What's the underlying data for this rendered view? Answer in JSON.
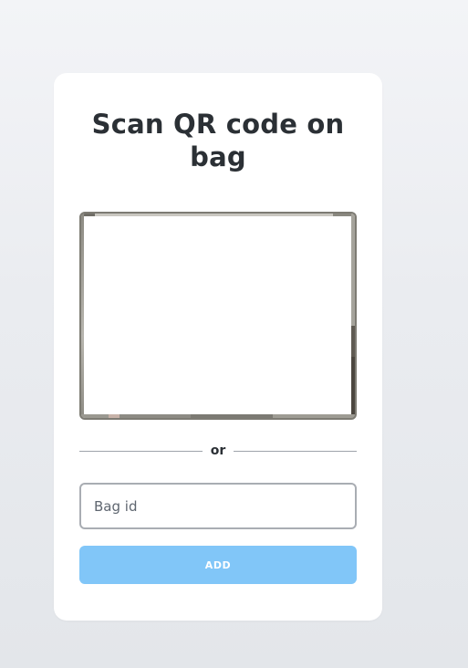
{
  "card": {
    "title": "Scan QR code on bag"
  },
  "divider": {
    "label": "or"
  },
  "bag_input": {
    "value": "",
    "placeholder": "Bag id"
  },
  "add_button": {
    "label": "ADD",
    "state": "disabled"
  },
  "colors": {
    "background": "#e9ebef",
    "card": "#ffffff",
    "title_text": "#2b3035",
    "divider_line": "#9ea3aa",
    "input_border": "#a9adb3",
    "button_bg": "#81c6f8",
    "button_text": "#ffffff"
  }
}
